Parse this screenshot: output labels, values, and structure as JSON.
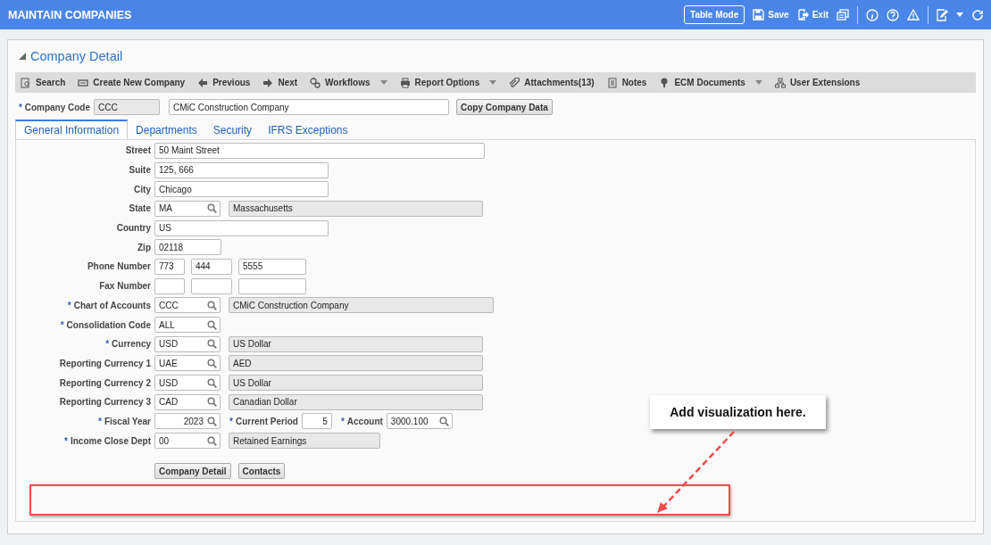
{
  "header": {
    "title": "MAINTAIN COMPANIES",
    "table_mode": "Table Mode",
    "save": "Save",
    "exit": "Exit"
  },
  "panel": {
    "title": "Company Detail",
    "expanded": true
  },
  "toolbar": [
    {
      "label": "Search",
      "dropdown": false
    },
    {
      "label": "Create New Company",
      "dropdown": false
    },
    {
      "label": "Previous",
      "dropdown": false
    },
    {
      "label": "Next",
      "dropdown": false
    },
    {
      "label": "Workflows",
      "dropdown": true
    },
    {
      "label": "Report Options",
      "dropdown": true
    },
    {
      "label": "Attachments(13)",
      "dropdown": false
    },
    {
      "label": "Notes",
      "dropdown": false
    },
    {
      "label": "ECM Documents",
      "dropdown": true
    },
    {
      "label": "User Extensions",
      "dropdown": false
    }
  ],
  "company": {
    "mark": "*",
    "label": "Company Code",
    "code": "CCC",
    "name": "CMiC Construction Company",
    "copy_button": "Copy Company Data"
  },
  "tabs": [
    {
      "label": "General Information",
      "selected": true
    },
    {
      "label": "Departments",
      "selected": false
    },
    {
      "label": "Security",
      "selected": false
    },
    {
      "label": "IFRS Exceptions",
      "selected": false
    }
  ],
  "fields": [
    {
      "kind": "text",
      "label": "Street",
      "value": "50 Maint Street"
    },
    {
      "kind": "text",
      "label": "Suite",
      "value": "125, 666"
    },
    {
      "kind": "text",
      "label": "City",
      "value": "Chicago"
    },
    {
      "kind": "lookup",
      "label": "State",
      "value": "MA",
      "description": "Massachusetts"
    },
    {
      "kind": "text",
      "label": "Country",
      "value": "US"
    },
    {
      "kind": "text",
      "label": "Zip",
      "value": "02118"
    },
    {
      "kind": "phone",
      "label": "Phone Number",
      "parts": [
        "773",
        "444",
        "5555"
      ]
    },
    {
      "kind": "phone",
      "label": "Fax Number"
    },
    {
      "kind": "lookup",
      "mark": "*",
      "label": "Chart of Accounts",
      "value": "CCC",
      "description": "CMiC Construction Company"
    },
    {
      "kind": "lookup",
      "mark": "*",
      "label": "Consolidation Code",
      "value": "ALL"
    },
    {
      "kind": "lookup",
      "mark": "*",
      "label": "Currency",
      "value": "USD",
      "description": "US Dollar"
    },
    {
      "kind": "lookup",
      "label": "Reporting Currency 1",
      "value": "UAE",
      "description": "AED"
    },
    {
      "kind": "lookup",
      "label": "Reporting Currency 2",
      "value": "USD",
      "description": "US Dollar"
    },
    {
      "kind": "lookup",
      "label": "Reporting Currency 3",
      "value": "CAD",
      "description": "Canadian Dollar"
    },
    {
      "kind": "fiscal",
      "mark": "*",
      "label": "Fiscal Year",
      "value": "2023",
      "period_mark": "*",
      "period_label": "Current Period",
      "period": "5",
      "account_mark": "*",
      "account_label": "Account",
      "account": "3000.100"
    },
    {
      "kind": "lookup",
      "mark": "*",
      "label": "Income Close Dept",
      "value": "00",
      "description": "Retained Earnings"
    }
  ],
  "buttons": [
    "Company Detail",
    "Contacts"
  ],
  "annotation": {
    "text": "Add visualization here."
  }
}
